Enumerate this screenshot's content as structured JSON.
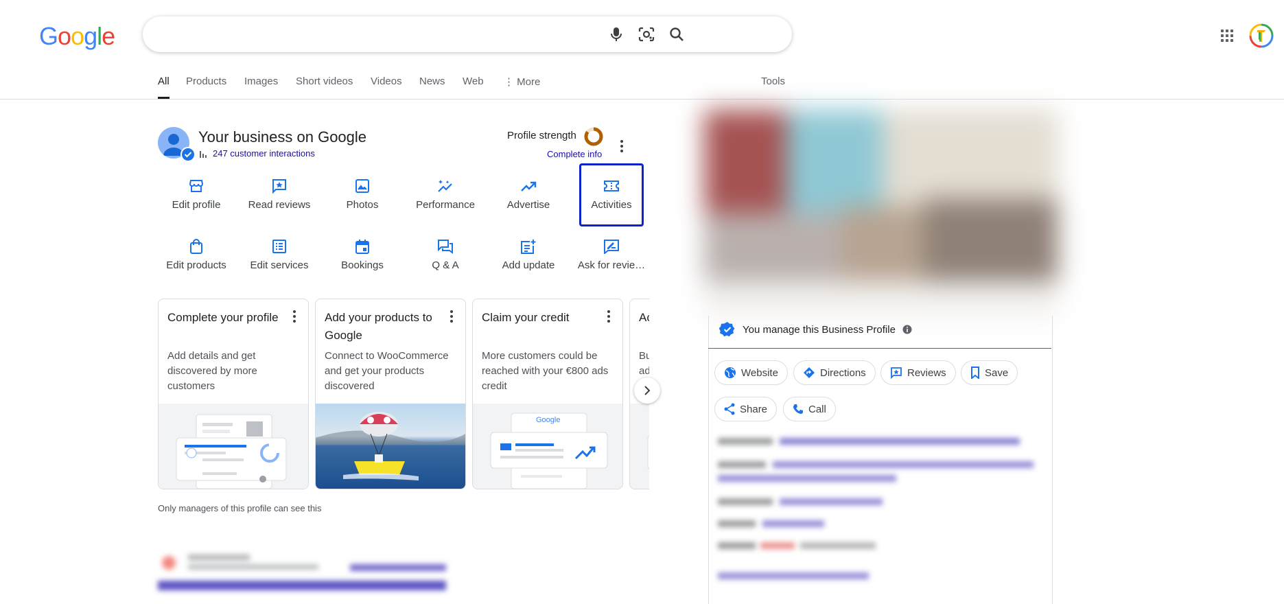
{
  "header": {
    "logo_letters": [
      "G",
      "o",
      "o",
      "g",
      "l",
      "e"
    ],
    "logo_colors": [
      "#4285F4",
      "#EA4335",
      "#FBBC05",
      "#4285F4",
      "#34A853",
      "#EA4335"
    ],
    "search": {
      "value": "",
      "placeholder": ""
    },
    "icons": [
      "microphone-icon",
      "lens-icon",
      "search-icon",
      "apps-grid-icon",
      "account-avatar"
    ]
  },
  "tabs": {
    "items": [
      "All",
      "Products",
      "Images",
      "Short videos",
      "Videos",
      "News",
      "Web",
      "More"
    ],
    "active": "All",
    "tools": "Tools"
  },
  "business": {
    "title": "Your business on Google",
    "interactions": "247 customer interactions",
    "profile_strength": "Profile strength",
    "complete_info": "Complete info",
    "profile_strength_level": 0.85,
    "actions": [
      {
        "label": "Edit profile",
        "icon": "store-icon"
      },
      {
        "label": "Read reviews",
        "icon": "review-star-icon"
      },
      {
        "label": "Photos",
        "icon": "image-icon"
      },
      {
        "label": "Performance",
        "icon": "sparkle-trend-icon"
      },
      {
        "label": "Advertise",
        "icon": "trending-up-icon"
      },
      {
        "label": "Activities",
        "icon": "ticket-icon"
      },
      {
        "label": "Edit products",
        "icon": "shopping-bag-icon"
      },
      {
        "label": "Edit services",
        "icon": "list-icon"
      },
      {
        "label": "Bookings",
        "icon": "calendar-icon"
      },
      {
        "label": "Q & A",
        "icon": "forum-icon"
      },
      {
        "label": "Add update",
        "icon": "post-add-icon"
      },
      {
        "label": "Ask for revie…",
        "icon": "rate-review-icon"
      }
    ],
    "highlighted_action": "Activities",
    "cards": [
      {
        "title": "Complete your profile",
        "desc": "Add details and get discovered by more customers"
      },
      {
        "title": "Add your products to Google",
        "desc": "Connect to WooCommerce and get your products discovered"
      },
      {
        "title": "Claim your credit",
        "desc": "More customers could be reached with your €800 ads credit",
        "image_brand": "Google"
      },
      {
        "title": "Ac",
        "desc": "Bu ad"
      }
    ],
    "managers_note": "Only managers of this profile can see this"
  },
  "panel": {
    "manage_text": "You manage this Business Profile",
    "chips": [
      "Website",
      "Directions",
      "Reviews",
      "Save",
      "Share",
      "Call"
    ]
  },
  "colors": {
    "accent_blue": "#1a73e8",
    "link": "#1a0dab",
    "highlight_box": "#0b24c6",
    "ring_progress": "#b06000"
  }
}
